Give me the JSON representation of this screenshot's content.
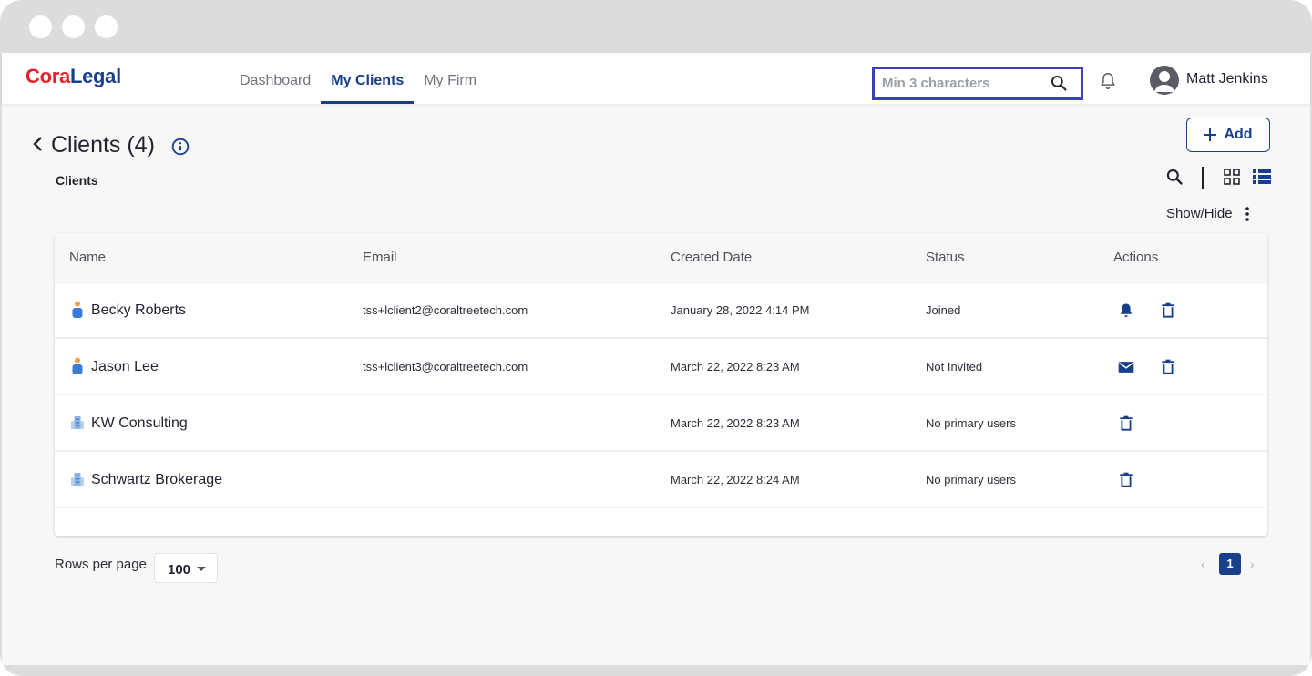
{
  "app": {
    "logo_part1": "Cora",
    "logo_part2": "Legal",
    "nav": [
      {
        "label": "Dashboard",
        "active": false
      },
      {
        "label": "My Clients",
        "active": true
      },
      {
        "label": "My Firm",
        "active": false
      }
    ],
    "search_placeholder": "Min 3 characters",
    "user_name": "Matt Jenkins"
  },
  "page": {
    "title": "Clients (4)",
    "subtitle": "Clients",
    "add_label": "Add",
    "show_hide_label": "Show/Hide"
  },
  "table": {
    "columns": [
      "Name",
      "Email",
      "Created Date",
      "Status",
      "Actions"
    ],
    "rows": [
      {
        "name": "Becky Roberts",
        "type": "person",
        "email": "tss+lclient2@coraltreetech.com",
        "created": "January 28, 2022 4:14 PM",
        "status": "Joined",
        "actions": [
          "bell-icon",
          "trash-icon"
        ]
      },
      {
        "name": "Jason Lee",
        "type": "person",
        "email": "tss+lclient3@coraltreetech.com",
        "created": "March 22, 2022 8:23 AM",
        "status": "Not Invited",
        "actions": [
          "mail-icon",
          "trash-icon"
        ]
      },
      {
        "name": "KW Consulting",
        "type": "company",
        "email": "",
        "created": "March 22, 2022 8:23 AM",
        "status": "No primary users",
        "actions": [
          "trash-icon"
        ]
      },
      {
        "name": "Schwartz Brokerage",
        "type": "company",
        "email": "",
        "created": "March 22, 2022 8:24 AM",
        "status": "No primary users",
        "actions": [
          "trash-icon"
        ]
      }
    ]
  },
  "pagination": {
    "rows_per_page_label": "Rows per page",
    "rows_per_page_value": "100",
    "current_page": "1",
    "prev_glyph": "‹",
    "next_glyph": "›"
  },
  "colors": {
    "brand_red": "#e0252b",
    "brand_blue": "#173f8a",
    "search_highlight": "#3b3fc2"
  }
}
